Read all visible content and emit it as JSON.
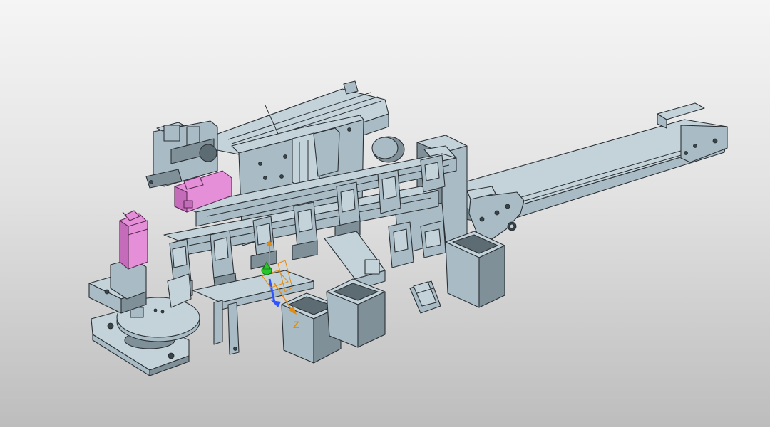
{
  "viewport": {
    "axis_labels": {
      "x": "",
      "y": "",
      "z": "Z"
    },
    "colors": {
      "background_top": "#f5f5f5",
      "background_bottom": "#bdbdbd",
      "part_face": "#a9bcc6",
      "part_face_dark": "#7f9099",
      "part_face_light": "#c4d3da",
      "edge": "#2b3034",
      "servo_motor": "#e48fd8",
      "axis_x": "#2f54ff",
      "axis_y": "#e28b12",
      "axis_z": "#2ac52a"
    },
    "icons": {
      "triad": "coordinate-triad-icon"
    }
  }
}
